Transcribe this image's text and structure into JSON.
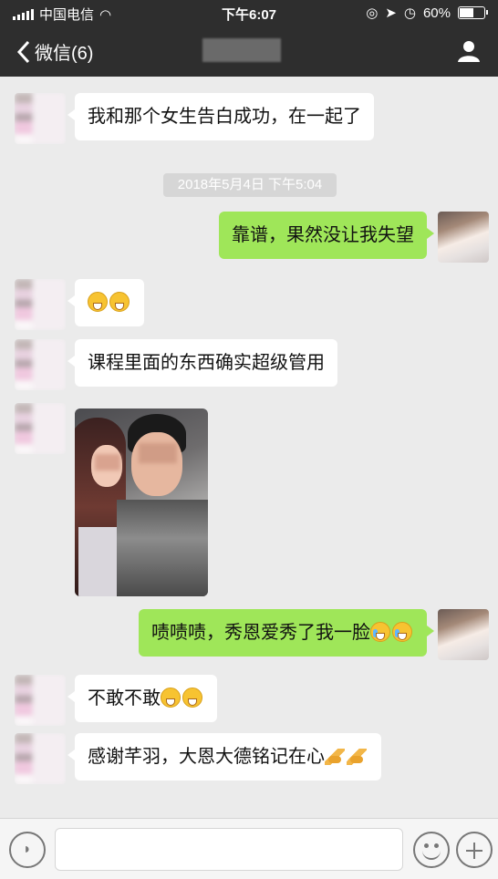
{
  "status_bar": {
    "carrier": "中国电信",
    "time": "下午6:07",
    "battery": "60%",
    "battery_level": 0.6
  },
  "nav": {
    "back_label": "微信(6)",
    "back_icon": "chevron-left-icon",
    "contact_icon": "person-icon"
  },
  "chat": {
    "timestamp": "2018年5月4日 下午5:04",
    "messages": [
      {
        "side": "in",
        "text": "我和那个女生告白成功，在一起了"
      },
      {
        "side": "out",
        "text": "靠谱，果然没让我失望"
      },
      {
        "side": "in",
        "text": "",
        "emojis": [
          "grin",
          "grin"
        ]
      },
      {
        "side": "in",
        "text": "课程里面的东西确实超级管用"
      },
      {
        "side": "in",
        "type": "image"
      },
      {
        "side": "out",
        "text": "啧啧啧，秀恩爱秀了我一脸",
        "emojis": [
          "cry-laugh",
          "cry-laugh"
        ]
      },
      {
        "side": "in",
        "text": "不敢不敢",
        "emojis": [
          "grin",
          "grin"
        ]
      },
      {
        "side": "in",
        "text": "感谢芊羽，大恩大德铭记在心",
        "emojis": [
          "pray",
          "pray"
        ]
      }
    ]
  },
  "input_bar": {
    "voice_icon": "voice-icon",
    "emoji_icon": "emoji-icon",
    "plus_icon": "plus-icon"
  },
  "colors": {
    "nav_bg": "#2e2e2e",
    "chat_bg": "#ebebeb",
    "bubble_out": "#9fe659",
    "bubble_in": "#ffffff"
  }
}
